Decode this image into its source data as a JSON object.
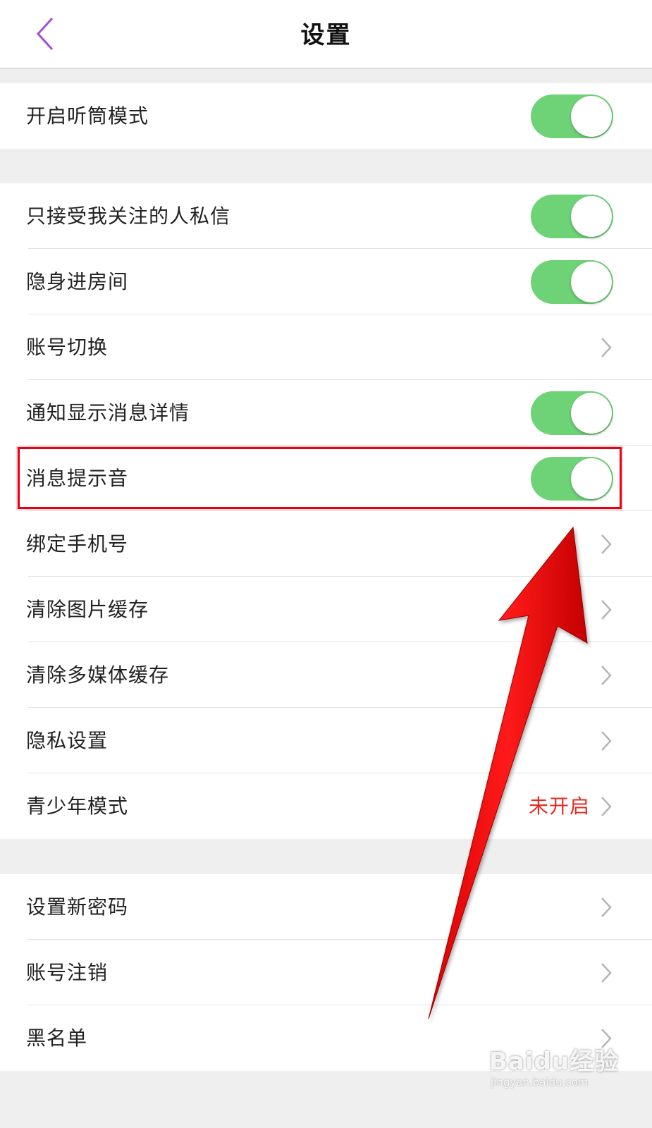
{
  "header": {
    "title": "设置"
  },
  "groups": [
    {
      "items": [
        {
          "label": "开启听筒模式",
          "control": "toggle",
          "on": true
        }
      ]
    },
    {
      "items": [
        {
          "label": "只接受我关注的人私信",
          "control": "toggle",
          "on": true
        },
        {
          "label": "隐身进房间",
          "control": "toggle",
          "on": true
        },
        {
          "label": "账号切换",
          "control": "chevron"
        },
        {
          "label": "通知显示消息详情",
          "control": "toggle",
          "on": true
        },
        {
          "label": "消息提示音",
          "control": "toggle",
          "on": true,
          "highlighted": true
        },
        {
          "label": "绑定手机号",
          "control": "chevron"
        },
        {
          "label": "清除图片缓存",
          "control": "chevron"
        },
        {
          "label": "清除多媒体缓存",
          "control": "chevron"
        },
        {
          "label": "隐私设置",
          "control": "chevron"
        },
        {
          "label": "青少年模式",
          "control": "chevron",
          "value": "未开启"
        }
      ]
    },
    {
      "items": [
        {
          "label": "设置新密码",
          "control": "chevron"
        },
        {
          "label": "账号注销",
          "control": "chevron"
        },
        {
          "label": "黑名单",
          "control": "chevron"
        }
      ]
    }
  ],
  "colors": {
    "accent_purple": "#a24fd8",
    "toggle_on": "#6ed377",
    "status_red": "#e82a20",
    "annotation_red": "#e60012"
  },
  "watermark": {
    "logo": "Baidu经验",
    "url": "jingyan.baidu.com"
  }
}
